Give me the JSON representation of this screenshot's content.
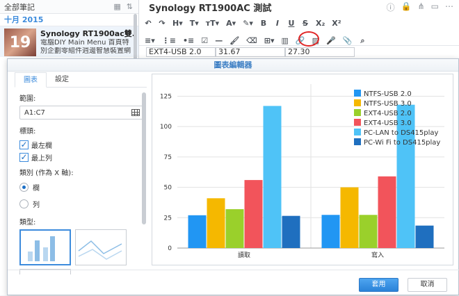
{
  "sidebar": {
    "header": "全部筆記",
    "month": "十月 2015",
    "note": {
      "thumb_text": "19",
      "title": "Synology RT1900ac雙...",
      "line1": "電腦DIY Main Menu 首頁特",
      "line2": "別企劃零組件週邊智慧裝置網"
    }
  },
  "editor": {
    "title": "Synology RT1900AC 測試",
    "table_cells": [
      "EXT4-USB 2.0",
      "31.67",
      "27.30"
    ]
  },
  "dialog": {
    "title": "圖表編輯器",
    "tabs": [
      "圖表",
      "設定"
    ],
    "range_label": "範圍:",
    "range_value": "A1:C7",
    "headers_label": "標頭:",
    "check_left": "最左欄",
    "check_top": "最上列",
    "category_label": "類別 (作為 X 軸):",
    "radio_column": "欄",
    "radio_row": "列",
    "type_label": "類型:",
    "apply": "套用",
    "cancel": "取消"
  },
  "colors": {
    "NTFS-USB 2.0": "#2196f3",
    "NTFS-USB 3.0": "#f5b800",
    "EXT4-USB 2.0": "#9ad02b",
    "EXT4-USB 3.0": "#f2545b",
    "PC-LAN to DS415play": "#4fc3f7",
    "PC-Wi Fi to DS415play": "#1f6fbf"
  },
  "chart_data": {
    "type": "bar",
    "categories": [
      "讀取",
      "寫入"
    ],
    "series": [
      {
        "name": "NTFS-USB 2.0",
        "values": [
          27,
          27.3
        ]
      },
      {
        "name": "NTFS-USB 3.0",
        "values": [
          41,
          50
        ]
      },
      {
        "name": "EXT4-USB 2.0",
        "values": [
          32,
          27.3
        ]
      },
      {
        "name": "EXT4-USB 3.0",
        "values": [
          56,
          59
        ]
      },
      {
        "name": "PC-LAN to DS415play",
        "values": [
          117,
          118
        ]
      },
      {
        "name": "PC-Wi Fi to DS415play",
        "values": [
          26.5,
          18.5
        ]
      }
    ],
    "yticks": [
      0,
      25,
      50,
      75,
      100,
      125
    ],
    "ylim": [
      0,
      135
    ],
    "grid": true,
    "legend": "top-right"
  }
}
